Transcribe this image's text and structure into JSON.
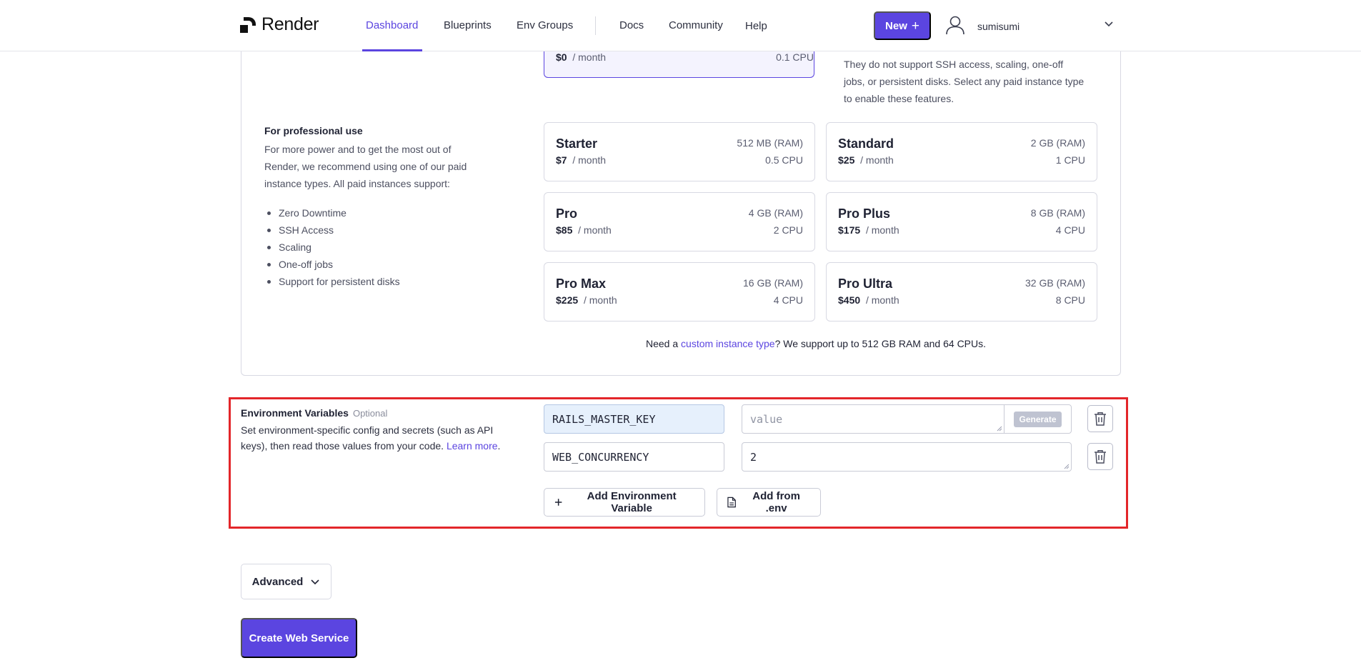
{
  "header": {
    "brand": "Render",
    "nav": [
      {
        "label": "Dashboard",
        "active": true
      },
      {
        "label": "Blueprints"
      },
      {
        "label": "Env Groups"
      },
      {
        "label": "Docs"
      },
      {
        "label": "Community"
      },
      {
        "label": "Help"
      }
    ],
    "new_label": "New",
    "username": "sumisumi"
  },
  "instance": {
    "free": {
      "price": "$0",
      "period": "/ month",
      "cpu": "0.1 CPU"
    },
    "free_note": "They do not support SSH access, scaling, one-off jobs, or persistent disks. Select any paid instance type to enable these features.",
    "pro_title": "For professional use",
    "pro_desc": "For more power and to get the most out of Render, we recommend using one of our paid instance types. All paid instances support:",
    "features": [
      "Zero Downtime",
      "SSH Access",
      "Scaling",
      "One-off jobs",
      "Support for persistent disks"
    ],
    "tiers": [
      {
        "name": "Starter",
        "price": "$7",
        "period": "/ month",
        "ram": "512 MB (RAM)",
        "cpu": "0.5 CPU"
      },
      {
        "name": "Standard",
        "price": "$25",
        "period": "/ month",
        "ram": "2 GB (RAM)",
        "cpu": "1 CPU"
      },
      {
        "name": "Pro",
        "price": "$85",
        "period": "/ month",
        "ram": "4 GB (RAM)",
        "cpu": "2 CPU"
      },
      {
        "name": "Pro Plus",
        "price": "$175",
        "period": "/ month",
        "ram": "8 GB (RAM)",
        "cpu": "4 CPU"
      },
      {
        "name": "Pro Max",
        "price": "$225",
        "period": "/ month",
        "ram": "16 GB (RAM)",
        "cpu": "4 CPU"
      },
      {
        "name": "Pro Ultra",
        "price": "$450",
        "period": "/ month",
        "ram": "32 GB (RAM)",
        "cpu": "8 CPU"
      }
    ],
    "custom": {
      "prefix": "Need a ",
      "link": "custom instance type",
      "suffix": "? We support up to 512 GB RAM and 64 CPUs."
    }
  },
  "env": {
    "title": "Environment Variables",
    "optional": "Optional",
    "desc": "Set environment-specific config and secrets (such as API keys), then read those values from your code.",
    "learn_more": "Learn more",
    "rows": [
      {
        "key": "RAILS_MASTER_KEY",
        "value": "",
        "value_placeholder": "value"
      },
      {
        "key": "WEB_CONCURRENCY",
        "value": "2"
      }
    ],
    "generate_label": "Generate",
    "add_var_label": "Add Environment Variable",
    "add_env_label": "Add from .env"
  },
  "advanced_label": "Advanced",
  "create_label": "Create Web Service",
  "colors": {
    "accent": "#5b45e0",
    "highlight": "#e3262a"
  }
}
